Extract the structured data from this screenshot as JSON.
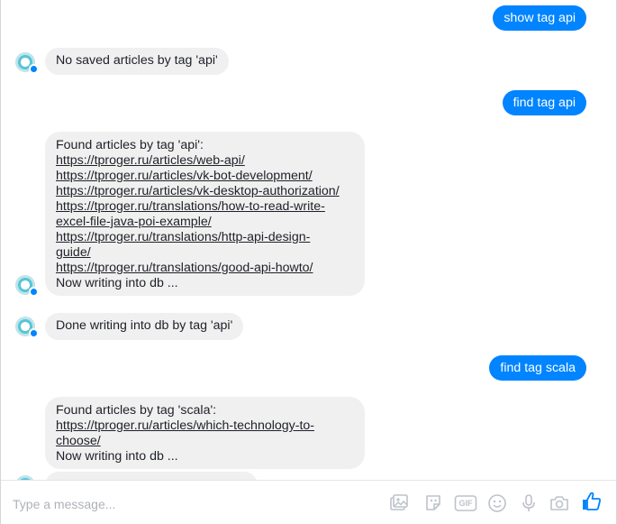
{
  "messages": {
    "out1": "show tag api",
    "in1": "No saved articles by tag 'api'",
    "out2": "find tag api",
    "in2": {
      "header": "Found articles by tag 'api':",
      "links": [
        "https://tproger.ru/articles/web-api/",
        "https://tproger.ru/articles/vk-bot-development/",
        "https://tproger.ru/articles/vk-desktop-authorization/",
        "https://tproger.ru/translations/how-to-read-write-",
        "excel-file-java-poi-example/",
        "https://tproger.ru/translations/http-api-design-",
        "guide/",
        "https://tproger.ru/translations/good-api-howto/"
      ],
      "footer": "Now writing into db ..."
    },
    "in3": "Done writing into db by tag 'api'",
    "out3": "find tag scala",
    "in4": {
      "header": "Found articles by tag 'scala':",
      "links": [
        "https://tproger.ru/articles/which-technology-to-",
        "choose/"
      ],
      "footer": "Now writing into db ..."
    }
  },
  "composer": {
    "placeholder": "Type a message...",
    "icons": [
      "photo-icon",
      "sticker-icon",
      "gif-icon",
      "emoji-icon",
      "microphone-icon",
      "camera-icon",
      "like-icon"
    ],
    "gif_label": "GIF"
  },
  "colors": {
    "outgoing": "#0084ff",
    "incoming": "#f1f0f0",
    "icon": "#bec2c9"
  }
}
